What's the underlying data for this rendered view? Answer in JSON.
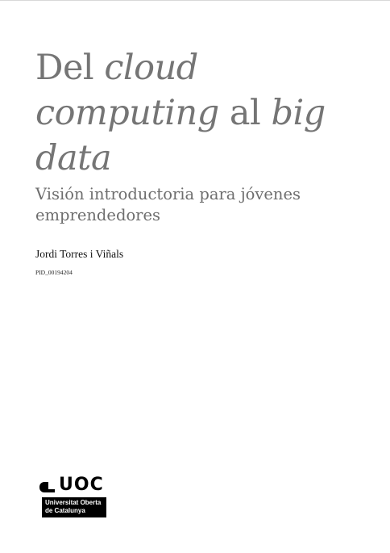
{
  "cover": {
    "title": {
      "part1": "Del ",
      "part2": "cloud",
      "part3": "computing",
      "part4": " al ",
      "part5": "big",
      "part6": "data"
    },
    "subtitle": "Visión introductoria para jóvenes emprendedores",
    "author": "Jordi Torres i Viñals",
    "pid": "PID_00194204"
  },
  "logo": {
    "wordmark": "UOC",
    "line1": "Universitat Oberta",
    "line2": "de Catalunya"
  }
}
